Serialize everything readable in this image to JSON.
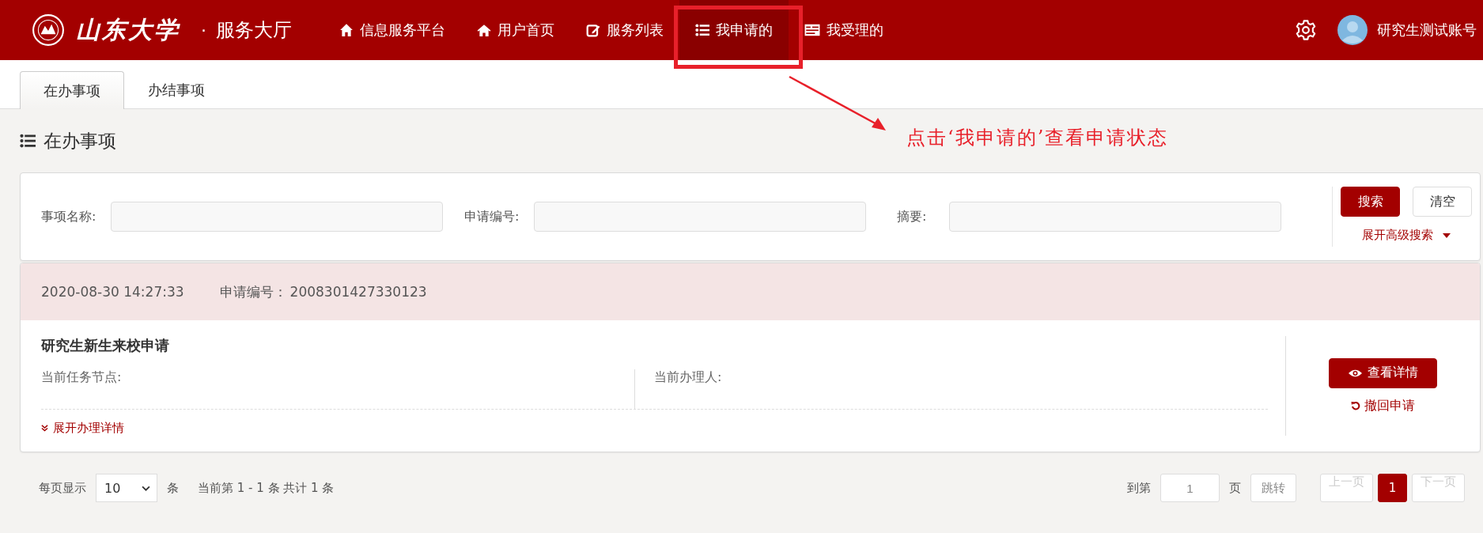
{
  "header": {
    "logo_text": "山东大学",
    "separator": "·",
    "title": "服务大厅",
    "nav": [
      {
        "label": "信息服务平台",
        "kind": "home",
        "selected": false
      },
      {
        "label": "用户首页",
        "kind": "house",
        "selected": false
      },
      {
        "label": "服务列表",
        "kind": "edit",
        "selected": false
      },
      {
        "label": "我申请的",
        "kind": "list",
        "selected": true
      },
      {
        "label": "我受理的",
        "kind": "card",
        "selected": false
      }
    ],
    "user": "研究生测试账号"
  },
  "annotation": {
    "text": "点击‘我申请的’查看申请状态"
  },
  "tabs": [
    {
      "label": "在办事项",
      "selected": true
    },
    {
      "label": "办结事项",
      "selected": false
    }
  ],
  "page_title": "在办事项",
  "search": {
    "fields": [
      {
        "label": "事项名称:"
      },
      {
        "label": "申请编号:"
      },
      {
        "label": "摘要:"
      }
    ],
    "search_button": "搜索",
    "clear_button": "清空",
    "advanced": "展开高级搜索"
  },
  "records": [
    {
      "datetime": "2020-08-30 14:27:33",
      "number_label": "申请编号：",
      "number": "2008301427330123",
      "title": "研究生新生来校申请",
      "node_label": "当前任务节点:",
      "handler_label": "当前办理人:",
      "expand": "展开办理详情",
      "view_button": "查看详情",
      "withdraw": "撤回申请"
    }
  ],
  "pagination": {
    "per_page_label": "每页显示",
    "per_page": "10",
    "per_page_unit": "条",
    "summary": "当前第 1 - 1 条 共计 1 条",
    "goto_label": "到第",
    "goto_value": "1",
    "goto_unit": "页",
    "jump": "跳转",
    "pages": [
      {
        "label": "上一页",
        "kind": "prev",
        "disabled": true,
        "selected": false
      },
      {
        "label": "1",
        "kind": "page",
        "disabled": false,
        "selected": true
      },
      {
        "label": "下一页",
        "kind": "next",
        "disabled": true,
        "selected": false
      }
    ]
  }
}
